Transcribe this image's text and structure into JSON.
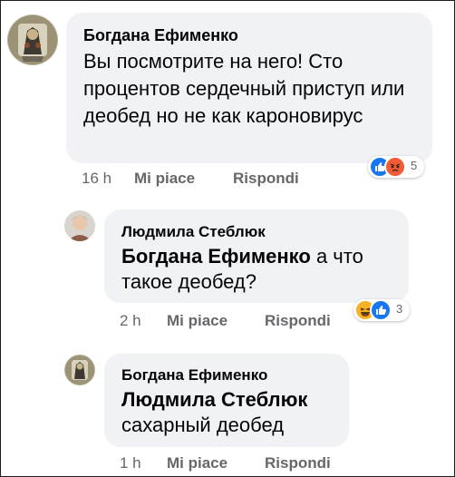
{
  "comments": [
    {
      "author": "Богдана Ефименко",
      "text": "Вы посмотрите на него! Сто процентов сердечный приступ или деобед но не как кароновирус",
      "time": "16 h",
      "like_label": "Mi piace",
      "reply_label": "Rispondi",
      "reactions": {
        "icons": [
          "like-icon",
          "angry-icon"
        ],
        "count": "5"
      }
    },
    {
      "author": "Людмила Стеблюк",
      "mention": "Богдана Ефименко",
      "text": "а что такое деобед?",
      "time": "2 h",
      "like_label": "Mi piace",
      "reply_label": "Rispondi",
      "reactions": {
        "icons": [
          "haha-icon",
          "like-icon"
        ],
        "count": "3"
      }
    },
    {
      "author": "Богдана Ефименко",
      "mention": "Людмила Стеблюк",
      "text": "сахарный деобед",
      "time": "1 h",
      "like_label": "Mi piace",
      "reply_label": "Rispondi"
    }
  ],
  "colors": {
    "bubble": "#f0f2f5",
    "secondary_text": "#65676b",
    "like_blue": "#1877f2",
    "angry": "#f15b36",
    "haha": "#f7b125"
  }
}
